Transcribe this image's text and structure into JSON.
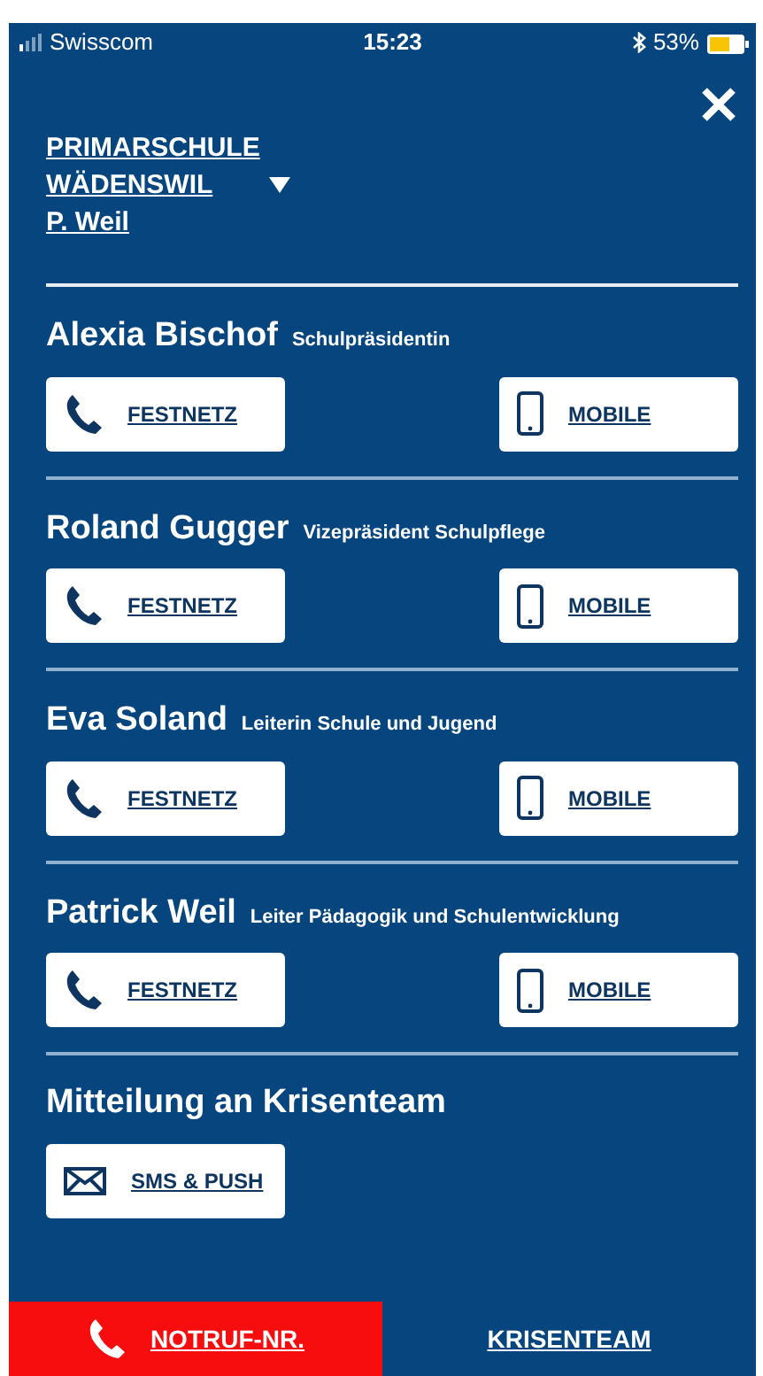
{
  "status_bar": {
    "carrier": "Swisscom",
    "time": "15:23",
    "battery": "53%"
  },
  "school": {
    "lines": [
      "PRIMARSCHULE",
      "WÄDENSWIL"
    ],
    "user": "P. Weil"
  },
  "contacts": [
    {
      "name": "Alexia Bischof",
      "role": "Schulpräsidentin",
      "buttons": [
        {
          "kind": "phone",
          "label": "FESTNETZ"
        },
        {
          "kind": "mobile",
          "label": "MOBILE"
        }
      ]
    },
    {
      "name": "Roland Gugger",
      "role": "Vizepräsident Schulpflege",
      "buttons": [
        {
          "kind": "phone",
          "label": "FESTNETZ"
        },
        {
          "kind": "mobile",
          "label": "MOBILE"
        }
      ]
    },
    {
      "name": "Eva Soland",
      "role": "Leiterin Schule und Jugend",
      "buttons": [
        {
          "kind": "phone",
          "label": "FESTNETZ"
        },
        {
          "kind": "mobile",
          "label": "MOBILE"
        }
      ]
    },
    {
      "name": "Patrick Weil",
      "role": "Leiter Pädagogik und Schulentwicklung",
      "buttons": [
        {
          "kind": "phone",
          "label": "FESTNETZ"
        },
        {
          "kind": "mobile",
          "label": "MOBILE"
        }
      ]
    }
  ],
  "message": {
    "title": "Mitteilung an Krisenteam",
    "buttons": [
      {
        "kind": "mail",
        "label": "SMS & PUSH"
      }
    ]
  },
  "tabs": [
    {
      "label": "NOTRUF-NR.",
      "selected": true,
      "kind": "phone"
    },
    {
      "label": "KRISENTEAM",
      "selected": false
    }
  ]
}
